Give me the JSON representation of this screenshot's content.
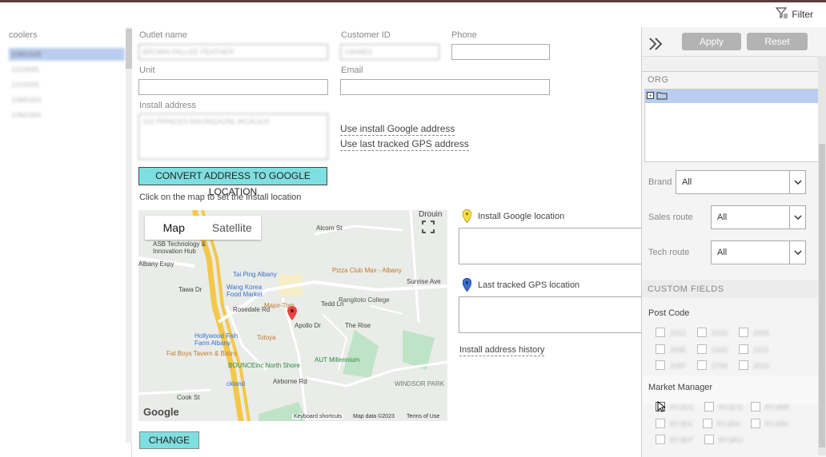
{
  "toolbar": {
    "filter_label": "Filter"
  },
  "left": {
    "header": "coolers",
    "items": [
      "10M1648",
      "1203685",
      "1203305",
      "10M5450",
      "10M2365"
    ]
  },
  "form": {
    "outlet_name_label": "Outlet name",
    "outlet_name_value": "BROWN PALLEE FEATHER",
    "customer_id_label": "Customer ID",
    "customer_id_value": "1364853",
    "phone_label": "Phone",
    "unit_label": "Unit",
    "email_label": "Email",
    "install_address_label": "Install address",
    "install_address_value": "115 PRINCES MAUNGAUNL MCALIUX",
    "use_install_google": "Use install Google address",
    "use_last_gps": "Use last tracked GPS address",
    "convert_button": "CONVERT ADDRESS TO GOOGLE LOCATION",
    "map_hint": "Click on the map to set the install location",
    "install_google_location": "Install Google location",
    "last_gps_location": "Last tracked GPS location",
    "install_history": "Install address history",
    "change_button": "CHANGE"
  },
  "map": {
    "tab_map": "Map",
    "tab_satellite": "Satellite",
    "google_logo": "Google",
    "footer_shortcuts": "Keyboard shortcuts",
    "footer_data": "Map data ©2023",
    "footer_terms": "Terms of Use",
    "pois": {
      "asb": "ASB Technology & Innovation Hub",
      "albany_expy": "Albany Expy",
      "tai_ping": "Tai Ping Albany",
      "pizza_club": "Pizza Club Max - Albany",
      "wang_korea": "Wang Korea Food Market",
      "major_tom": "Major-Tom",
      "rangitoto": "Rangitoto College",
      "hollywood_fish": "Hollywood Fish Farm Albany",
      "totoya": "Totoya",
      "fat_boys": "Fat Boys Tavern & Bistro",
      "bounce": "BOUNCEinc North Shore",
      "aut": "AUT Millennium",
      "kland": "ckland",
      "windsor": "WINDSOR PARK",
      "cook_st": "Cook St",
      "alcorn": "Alcorn St",
      "sunrise": "Sunrise Ave",
      "drouin": "Drouin",
      "rosedale": "Rosedale Rd",
      "apollo": "Apollo Dr",
      "tawa": "Tawa Dr",
      "ted_ln": "Tedd Ln",
      "the_rise": "The Rise",
      "airborne": "Airborne Rd"
    }
  },
  "right": {
    "apply": "Apply",
    "reset": "Reset",
    "org_header": "ORG",
    "brand_label": "Brand",
    "brand_value": "All",
    "sales_route_label": "Sales route",
    "sales_route_value": "All",
    "tech_route_label": "Tech route",
    "tech_route_value": "All",
    "custom_fields_header": "CUSTOM FIELDS",
    "post_code_label": "Post Code",
    "post_codes": [
      "2152",
      "2150",
      "2026",
      "2095",
      "2443",
      "2151",
      "2087",
      "2794",
      "2010"
    ],
    "market_manager_label": "Market Manager",
    "market_managers": [
      "RY3CC",
      "RY3CS",
      "RY3RR",
      "RY3FE",
      "RY3FA",
      "RY3RV",
      "RY3DT",
      "RY3RU"
    ]
  },
  "colors": {
    "accent_teal": "#7fdfe0",
    "selection": "#b9cdee"
  }
}
